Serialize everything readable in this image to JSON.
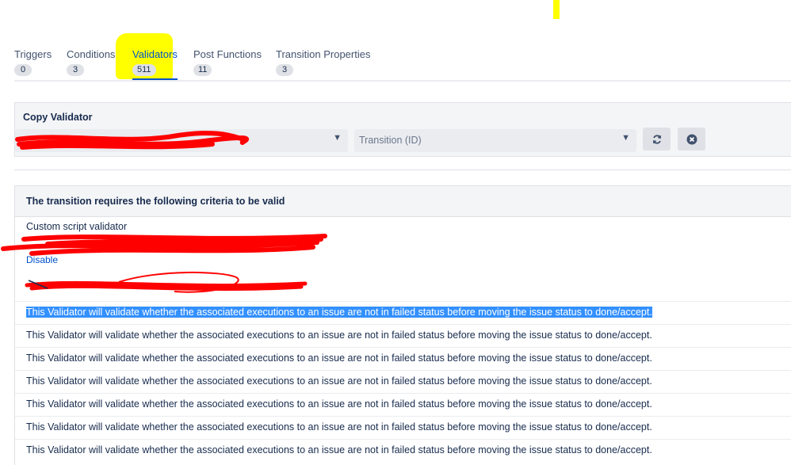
{
  "tabs": [
    {
      "label": "Triggers",
      "count": "0"
    },
    {
      "label": "Conditions",
      "count": "3"
    },
    {
      "label": "Validators",
      "count": "511"
    },
    {
      "label": "Post Functions",
      "count": "11"
    },
    {
      "label": "Transition Properties",
      "count": "3"
    }
  ],
  "active_tab": "Validators",
  "copy_validator": {
    "title": "Copy Validator",
    "workflow_select_value": "",
    "transition_placeholder": "Transition (ID)",
    "refresh_icon": "refresh-icon",
    "clear_icon": "close-circle-icon"
  },
  "criteria": {
    "heading": "The transition requires the following criteria to be valid",
    "validator_name": "Custom script validator",
    "disable_label": "Disable",
    "rows": [
      "This Validator will validate whether the associated executions to an issue are not in failed status before moving the issue status to done/accept.",
      "This Validator will validate whether the associated executions to an issue are not in failed status before moving the issue status to done/accept.",
      "This Validator will validate whether the associated executions to an issue are not in failed status before moving the issue status to done/accept.",
      "This Validator will validate whether the associated executions to an issue are not in failed status before moving the issue status to done/accept.",
      "This Validator will validate whether the associated executions to an issue are not in failed status before moving the issue status to done/accept.",
      "This Validator will validate whether the associated executions to an issue are not in failed status before moving the issue status to done/accept.",
      "This Validator will validate whether the associated executions to an issue are not in failed status before moving the issue status to done/accept."
    ]
  },
  "colors": {
    "highlight": "#ffff00",
    "redaction": "#ff0000",
    "selection": "#3390ff",
    "link": "#0052cc"
  }
}
